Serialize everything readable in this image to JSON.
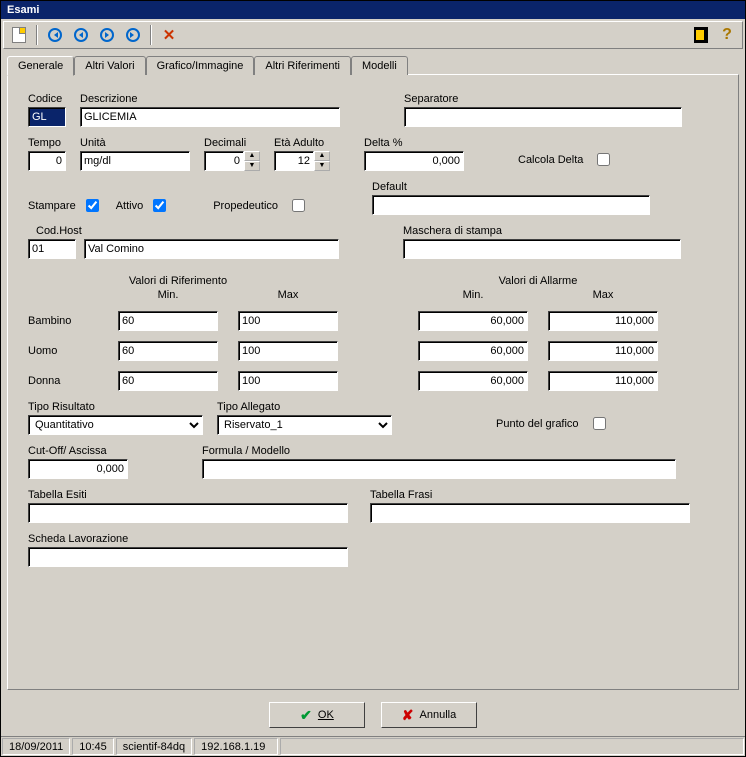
{
  "window": {
    "title": "Esami"
  },
  "tabs": [
    "Generale",
    "Altri Valori",
    "Grafico/Immagine",
    "Altri Riferimenti",
    "Modelli"
  ],
  "labels": {
    "codice": "Codice",
    "descrizione": "Descrizione",
    "separatore": "Separatore",
    "tempo": "Tempo",
    "unita": "Unità",
    "decimali": "Decimali",
    "eta_adulto": "Età Adulto",
    "delta_pct": "Delta %",
    "calcola_delta": "Calcola Delta",
    "stampare": "Stampare",
    "attivo": "Attivo",
    "propedeutico": "Propedeutico",
    "default": "Default",
    "cod_host": "Cod.Host",
    "maschera": "Maschera di stampa",
    "val_rif": "Valori di Riferimento",
    "val_all": "Valori di Allarme",
    "min": "Min.",
    "max": "Max",
    "bambino": "Bambino",
    "uomo": "Uomo",
    "donna": "Donna",
    "tipo_risultato": "Tipo Risultato",
    "tipo_allegato": "Tipo Allegato",
    "punto_grafico": "Punto del grafico",
    "cut_off": "Cut-Off/ Ascissa",
    "formula": "Formula / Modello",
    "tab_esiti": "Tabella Esiti",
    "tab_frasi": "Tabella Frasi",
    "scheda_lav": "Scheda Lavorazione"
  },
  "values": {
    "codice": "GL",
    "descrizione": "GLICEMIA",
    "separatore": "",
    "tempo": "0",
    "unita": "mg/dl",
    "decimali": "0",
    "eta_adulto": "12",
    "delta_pct": "0,000",
    "calcola_delta": false,
    "stampare": true,
    "attivo": true,
    "propedeutico": false,
    "default": "",
    "cod_host_a": "01",
    "cod_host_b": "Val Comino",
    "maschera": "",
    "rif": {
      "bambino": {
        "min": "60",
        "max": "100"
      },
      "uomo": {
        "min": "60",
        "max": "100"
      },
      "donna": {
        "min": "60",
        "max": "100"
      }
    },
    "all": {
      "bambino": {
        "min": "60,000",
        "max": "110,000"
      },
      "uomo": {
        "min": "60,000",
        "max": "110,000"
      },
      "donna": {
        "min": "60,000",
        "max": "110,000"
      }
    },
    "tipo_risultato": "Quantitativo",
    "tipo_allegato": "Riservato_1",
    "punto_grafico": false,
    "cut_off": "0,000",
    "formula": "",
    "tab_esiti": "",
    "tab_frasi": "",
    "scheda_lav": ""
  },
  "buttons": {
    "ok": "OK",
    "cancel": "Annulla"
  },
  "status": {
    "date": "18/09/2011",
    "time": "10:45",
    "host": "scientif-84dq",
    "ip": "192.168.1.19"
  }
}
